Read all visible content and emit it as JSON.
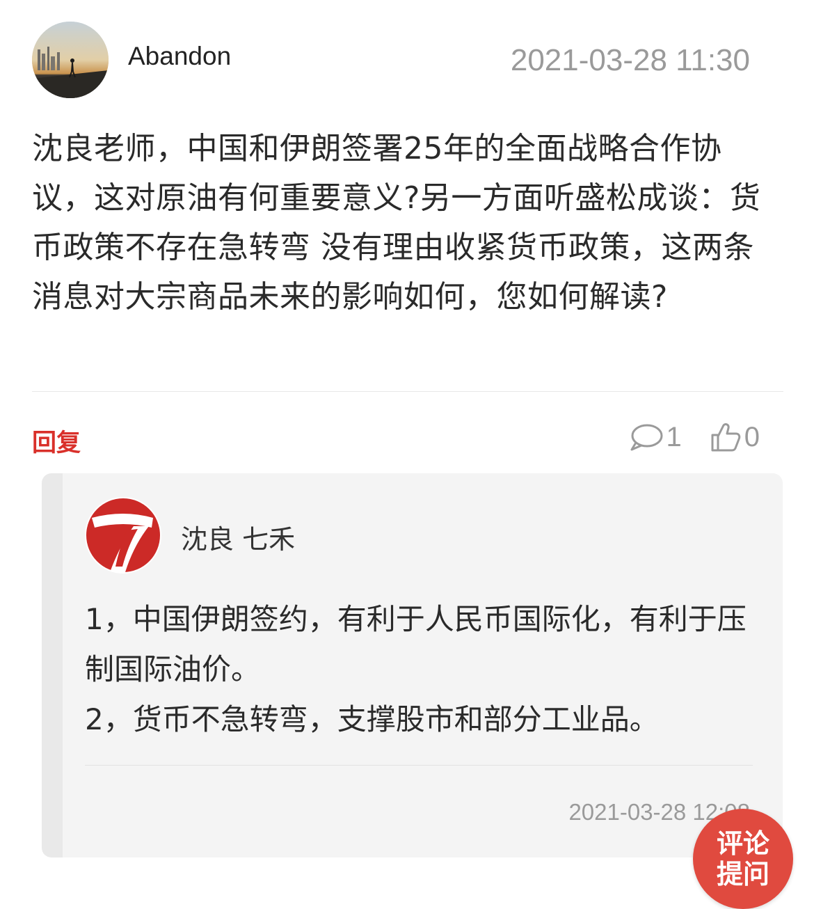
{
  "post": {
    "username": "Abandon",
    "timestamp": "2021-03-28 11:30",
    "question": "沈良老师，中国和伊朗签署25年的全面战略合作协议，这对原油有何重要意义?另一方面听盛松成谈：货币政策不存在急转弯 没有理由收紧货币政策，这两条消息对大宗商品未来的影响如何，您如何解读?"
  },
  "actions": {
    "reply_label": "回复",
    "comment_count": "1",
    "like_count": "0"
  },
  "reply": {
    "author": "沈良 七禾",
    "lines": [
      "1，中国伊朗签约，有利于人民币国际化，有利于压制国际油价。",
      "2，货币不急转弯，支撑股市和部分工业品。"
    ],
    "timestamp": "2021-03-28 12:08"
  },
  "fab": {
    "line1": "评论",
    "line2": "提问"
  },
  "colors": {
    "accent_red": "#d9302a",
    "fab_red": "#e04a3f",
    "muted_gray": "#9a9a9a"
  }
}
